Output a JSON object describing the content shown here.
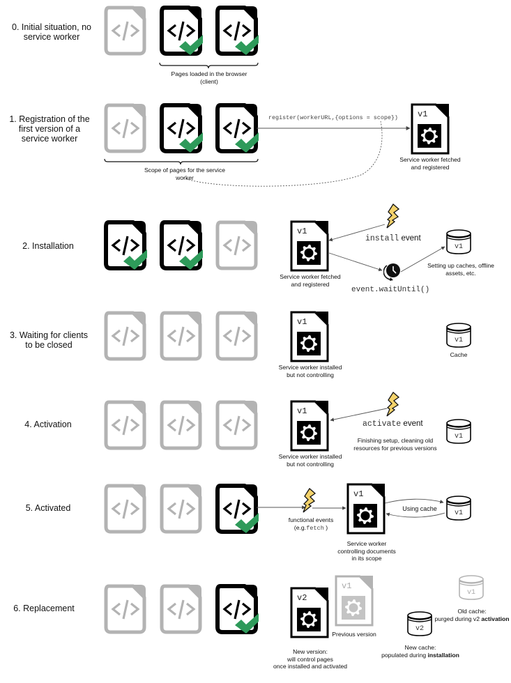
{
  "steps": [
    {
      "id": "initial",
      "label": "0. Initial situation, no service worker",
      "label_lines": [
        "0. Initial situation, no",
        "service worker"
      ],
      "pages": [
        {
          "state": "inactive",
          "checked": false
        },
        {
          "state": "active",
          "checked": true
        },
        {
          "state": "active",
          "checked": true
        }
      ],
      "bracket_caption_lines": [
        "Pages loaded in the browser",
        "(client)"
      ]
    },
    {
      "id": "registration",
      "label_lines": [
        "1. Registration of the",
        "first version of a",
        "service worker"
      ],
      "pages": [
        {
          "state": "inactive",
          "checked": false
        },
        {
          "state": "active",
          "checked": true
        },
        {
          "state": "active",
          "checked": true
        }
      ],
      "bracket_caption_lines": [
        "Scope of pages for the service",
        "worker"
      ],
      "call_label": "register(workerURL,{options = scope})",
      "worker": {
        "version": "v1",
        "state": "active"
      },
      "worker_caption_lines": [
        "Service worker fetched",
        "and registered"
      ]
    },
    {
      "id": "installation",
      "label_lines": [
        "2. Installation"
      ],
      "pages": [
        {
          "state": "active",
          "checked": true
        },
        {
          "state": "active",
          "checked": true
        },
        {
          "state": "inactive",
          "checked": false
        }
      ],
      "worker": {
        "version": "v1",
        "state": "active"
      },
      "worker_caption_lines": [
        "Service worker fetched",
        "and registered"
      ],
      "event_code": "install",
      "event_word": "event",
      "wait_label": "event.waitUntil()",
      "cache": {
        "version": "v1",
        "state": "active"
      },
      "cache_caption_lines": [
        "Setting up caches, offline",
        "assets, etc."
      ]
    },
    {
      "id": "waiting",
      "label_lines": [
        "3. Waiting for clients",
        "to be closed"
      ],
      "pages": [
        {
          "state": "inactive",
          "checked": false
        },
        {
          "state": "inactive",
          "checked": false
        },
        {
          "state": "inactive",
          "checked": false
        }
      ],
      "worker": {
        "version": "v1",
        "state": "active"
      },
      "worker_caption_lines": [
        "Service worker installed",
        "but not controlling"
      ],
      "cache": {
        "version": "v1",
        "state": "active"
      },
      "cache_caption_lines": [
        "Cache"
      ]
    },
    {
      "id": "activation",
      "label_lines": [
        "4. Activation"
      ],
      "pages": [
        {
          "state": "inactive",
          "checked": false
        },
        {
          "state": "inactive",
          "checked": false
        },
        {
          "state": "inactive",
          "checked": false
        }
      ],
      "worker": {
        "version": "v1",
        "state": "active"
      },
      "worker_caption_lines": [
        "Service worker installed",
        "but not controlling"
      ],
      "event_code": "activate",
      "event_word": "event",
      "event_caption_lines": [
        "Finishing setup, cleaning old",
        "resources for previous versions"
      ],
      "cache": {
        "version": "v1",
        "state": "active"
      }
    },
    {
      "id": "activated",
      "label_lines": [
        "5. Activated"
      ],
      "pages": [
        {
          "state": "inactive",
          "checked": false
        },
        {
          "state": "inactive",
          "checked": false
        },
        {
          "state": "active",
          "checked": true
        }
      ],
      "functional_events_text": "functional events",
      "functional_events_example_prefix": "(e.g.",
      "functional_events_example_code": "fetch",
      "functional_events_example_suffix": " )",
      "worker": {
        "version": "v1",
        "state": "active"
      },
      "worker_caption_lines": [
        "Service worker",
        "controlling documents",
        "in its scope"
      ],
      "cache_link_label": "Using cache",
      "cache": {
        "version": "v1",
        "state": "active"
      }
    },
    {
      "id": "replacement",
      "label_lines": [
        "6. Replacement"
      ],
      "pages": [
        {
          "state": "inactive",
          "checked": false
        },
        {
          "state": "inactive",
          "checked": false
        },
        {
          "state": "active",
          "checked": true
        }
      ],
      "new_worker": {
        "version": "v2",
        "state": "active"
      },
      "new_worker_caption_lines": [
        "New version:",
        "will control pages",
        "once installed and activated"
      ],
      "old_worker": {
        "version": "v1",
        "state": "inactive"
      },
      "old_worker_caption": "Previous version",
      "new_cache": {
        "version": "v2",
        "state": "active"
      },
      "new_cache_caption_line1": "New cache:",
      "new_cache_caption_prefix": "populated during ",
      "new_cache_caption_bold": "installation",
      "old_cache": {
        "version": "v1",
        "state": "inactive"
      },
      "old_cache_caption_line1": "Old cache:",
      "old_cache_caption_prefix": "purged during v2 ",
      "old_cache_caption_bold": "activation"
    }
  ],
  "colors": {
    "active_stroke": "#000000",
    "inactive_stroke": "#b3b3b3",
    "check_green": "#2e9a5a",
    "bolt_fill": "#f5d36b",
    "connector": "#555555"
  },
  "icons": {
    "page": "code-document-icon",
    "check": "checkmark-icon",
    "worker": "gear-document-icon",
    "cache": "database-cylinder-icon",
    "event": "lightning-bolt-icon",
    "wait": "clock-icon"
  }
}
